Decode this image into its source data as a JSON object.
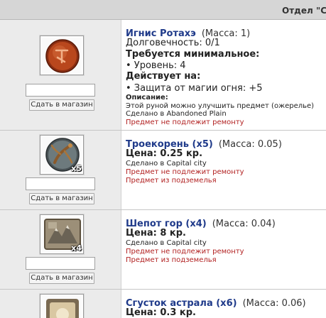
{
  "header": {
    "title": "Отдел \"С"
  },
  "common": {
    "sell_button": "Сдать в магазин"
  },
  "colors": {
    "name": "#1f3a8a",
    "warning": "#b22222",
    "left_panel": "#ebebeb",
    "header": "#d6d6d6"
  },
  "items": [
    {
      "icon": "copper-rune-icon",
      "name": "Игнис Ротахэ",
      "mass": "(Масса: 1)",
      "durability": "Долговечность: 0/1",
      "requirements_title": "Требуется минимальное:",
      "requirement": "• Уровень: 4",
      "effect_title": "Действует на:",
      "effect": "• Защита от магии огня: +5",
      "description_title": "Описание:",
      "description": "Этой руной можно улучшить предмет (ожерелье)",
      "made_in": "Сделано в Abandoned Plain",
      "repair": "Предмет не подлежит ремонту"
    },
    {
      "icon": "root-icon",
      "qty": "x5",
      "name": "Троекорень (x5)",
      "mass": "(Масса: 0.05)",
      "price": "Цена: 0.25 кр.",
      "made_in": "Сделано в Capital city",
      "repair": "Предмет не подлежит ремонту",
      "dungeon": "Предмет из подземелья"
    },
    {
      "icon": "mountain-whisper-icon",
      "qty": "x4",
      "name": "Шепот гор (x4)",
      "mass": "(Масса: 0.04)",
      "price": "Цена: 8 кр.",
      "made_in": "Сделано в Capital city",
      "repair": "Предмет не подлежит ремонту",
      "dungeon": "Предмет из подземелья"
    },
    {
      "icon": "astral-clot-icon",
      "name": "Сгусток астрала (x6)",
      "mass": "(Масса: 0.06)",
      "price": "Цена: 0.3 кр."
    }
  ]
}
